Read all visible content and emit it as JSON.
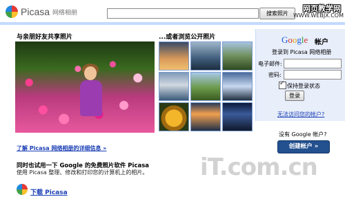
{
  "header": {
    "brand": "Picasa",
    "brand_sub": "网络相册",
    "search_button": "搜索照片",
    "watermark_title": "网页教学网",
    "watermark_url": "WWW.WEBJX.COM"
  },
  "left": {
    "heading": "与亲朋好友共享照片",
    "learn_more": "了解 Picasa 网络相册的详细信息 »",
    "promo_title": "同时也试用一下 Google 的免费照片软件 Picasa",
    "promo_text": "使用 Picasa 整理、修改和打印您的计算机上的相片。",
    "download_link": "下载 Picasa"
  },
  "browse": {
    "heading": "...或者浏览公开照片"
  },
  "signin": {
    "google_letters": [
      "G",
      "o",
      "o",
      "g",
      "l",
      "e"
    ],
    "account_label": "帐户",
    "description": "登录到 Picasa 网络相册",
    "email_label": "电子邮件:",
    "password_label": "密码:",
    "remember_label": "保持登录状态",
    "login_button": "登录",
    "cant_access": "无法访问您的帐户?"
  },
  "create": {
    "no_account": "没有 Google 帐户?",
    "button": "创建帐户 »"
  },
  "watermark": "iT.com.cn"
}
